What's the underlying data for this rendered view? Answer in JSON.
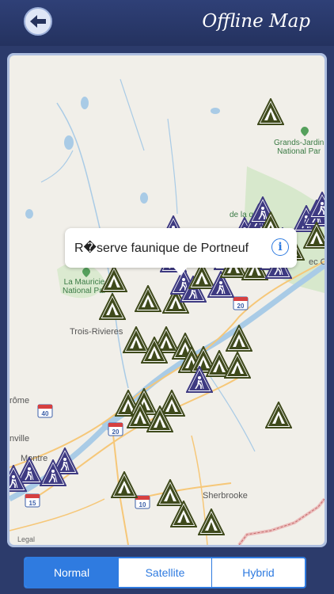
{
  "header": {
    "title": "Offline Map",
    "back_icon": "back-arrow-icon"
  },
  "map": {
    "callout": {
      "text": "R\u0000serve faunique de Portneuf",
      "display_text": "R�serve faunique de Portneuf",
      "info_icon": "info-icon"
    },
    "labels": {
      "trois_rivieres": "Trois-Rivieres",
      "sherbrooke": "Sherbrooke",
      "montreal": "Montre",
      "romorantin": "rôme",
      "granby": "nville",
      "quebec": "ec Ci",
      "grands_jardins": "Grands-Jardin\nNational Par",
      "mauricie": "La Mauricie\nNational Par",
      "laurentides": "de la\u0000 ques-"
    },
    "highway_shields": [
      "40",
      "20",
      "20",
      "15",
      "10"
    ],
    "legal": "Legal",
    "marker_icons": [
      "camping-icon",
      "hiking-icon"
    ]
  },
  "segments": {
    "items": [
      "Normal",
      "Satellite",
      "Hybrid"
    ],
    "selected": "Normal"
  },
  "colors": {
    "header": "#2c3b6b",
    "accent": "#2f7be0",
    "camp_marker": "#3f4a1c",
    "hike_marker": "#3e3a82"
  }
}
